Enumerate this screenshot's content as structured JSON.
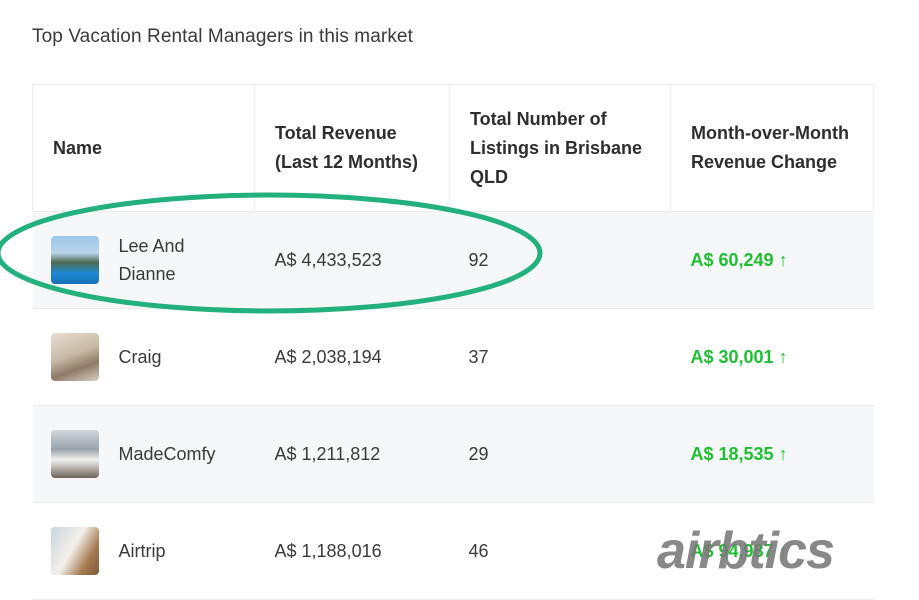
{
  "section_title": "Top Vacation Rental Managers in this market",
  "table": {
    "headers": [
      "Name",
      "Total Revenue (Last 12 Months)",
      "Total Number of Listings in Brisbane QLD",
      "Month-over-Month Revenue Change"
    ],
    "rows": [
      {
        "name": "Lee And Dianne",
        "thumb_icon": "pool-photo-icon",
        "revenue": "A$ 4,433,523",
        "listings": "92",
        "change": "A$ 60,249 ↑"
      },
      {
        "name": "Craig",
        "thumb_icon": "room-photo-icon",
        "revenue": "A$ 2,038,194",
        "listings": "37",
        "change": "A$ 30,001 ↑"
      },
      {
        "name": "MadeComfy",
        "thumb_icon": "bedroom-photo-icon",
        "revenue": "A$ 1,211,812",
        "listings": "29",
        "change": "A$ 18,535 ↑"
      },
      {
        "name": "Airtrip",
        "thumb_icon": "living-room-photo-icon",
        "revenue": "A$ 1,188,016",
        "listings": "46",
        "change": "A$ 94,987 ↑"
      }
    ]
  },
  "colors": {
    "positive_change": "#1fbf32",
    "highlight_oval": "#22b07d",
    "row_stripe": "#f6f7f8"
  },
  "watermark": {
    "text": "airbtics"
  }
}
